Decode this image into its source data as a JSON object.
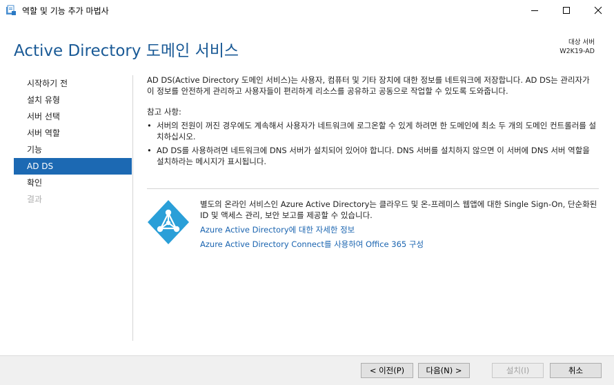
{
  "window": {
    "title": "역할 및 기능 추가 마법사",
    "icons": [
      "wizard-icon",
      "minimize-icon",
      "maximize-icon",
      "close-icon"
    ]
  },
  "header": {
    "title": "Active Directory 도메인 서비스",
    "target_label": "대상 서버",
    "target_server": "W2K19-AD"
  },
  "nav": {
    "items": [
      {
        "label": "시작하기 전",
        "state": "normal"
      },
      {
        "label": "설치 유형",
        "state": "normal"
      },
      {
        "label": "서버 선택",
        "state": "normal"
      },
      {
        "label": "서버 역할",
        "state": "normal"
      },
      {
        "label": "기능",
        "state": "normal"
      },
      {
        "label": "AD DS",
        "state": "active"
      },
      {
        "label": "확인",
        "state": "normal"
      },
      {
        "label": "결과",
        "state": "disabled"
      }
    ]
  },
  "content": {
    "intro": "AD DS(Active Directory 도메인 서비스)는 사용자, 컴퓨터 및 기타 장치에 대한 정보를 네트워크에 저장합니다. AD DS는 관리자가 이 정보를 안전하게 관리하고 사용자들이 편리하게 리소스를 공유하고 공동으로 작업할 수 있도록 도와줍니다.",
    "notes_title": "참고 사항:",
    "bullets": [
      "서버의 전원이 꺼진 경우에도 계속해서 사용자가 네트워크에 로그온할 수 있게 하려면 한 도메인에 최소 두 개의 도메인 컨트롤러를 설치하십시오.",
      "AD DS를 사용하려면 네트워크에 DNS 서버가 설치되어 있어야 합니다. DNS 서버를 설치하지 않으면 이 서버에 DNS 서버 역할을 설치하라는 메시지가 표시됩니다."
    ],
    "azure_text": "별도의 온라인 서비스인 Azure Active Directory는 클라우드 및 온-프레미스 웹앱에 대한 Single Sign-On, 단순화된 ID 및 액세스 관리, 보안 보고를 제공할 수 있습니다.",
    "link1": "Azure Active Directory에 대한 자세한 정보",
    "link2": "Azure Active Directory Connect를 사용하여 Office 365 구성",
    "azure_color": "#2a9fd8"
  },
  "footer": {
    "prev": "< 이전(P)",
    "next": "다음(N) >",
    "install": "설치(I)",
    "cancel": "취소"
  }
}
